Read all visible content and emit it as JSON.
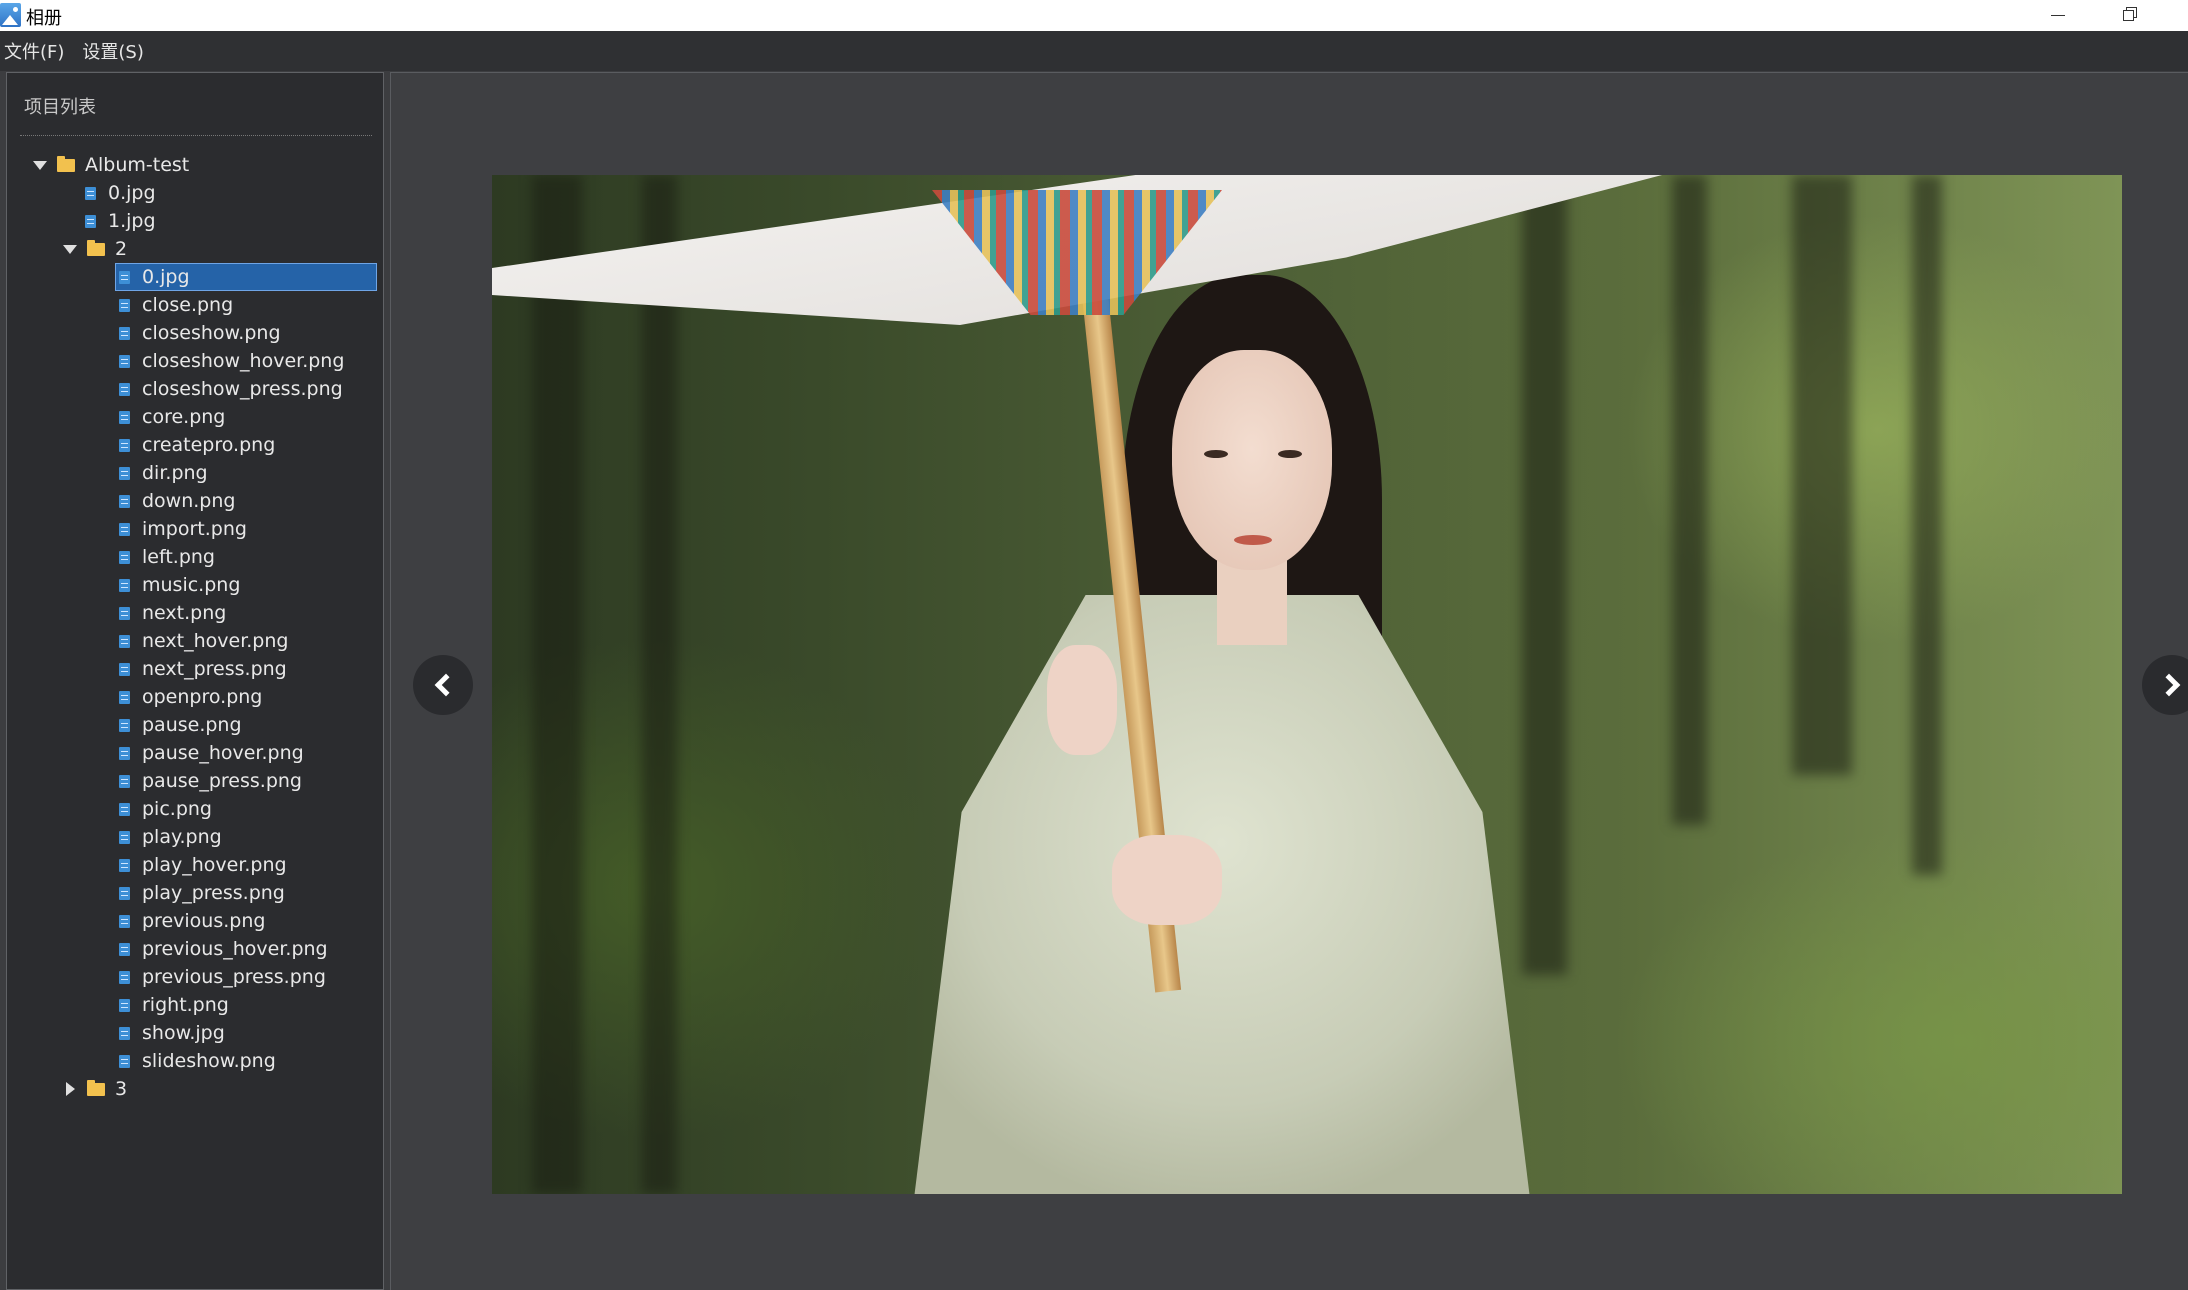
{
  "window": {
    "title": "相册",
    "controls": [
      "minimize",
      "restore"
    ]
  },
  "menu": {
    "file": "文件(F)",
    "settings": "设置(S)"
  },
  "sidebar": {
    "title": "项目列表",
    "tree": {
      "root": {
        "label": "Album-test",
        "expanded": true
      },
      "root_files": [
        "0.jpg",
        "1.jpg"
      ],
      "folder_2": {
        "label": "2",
        "expanded": true
      },
      "folder_2_files": [
        "0.jpg",
        "close.png",
        "closeshow.png",
        "closeshow_hover.png",
        "closeshow_press.png",
        "core.png",
        "createpro.png",
        "dir.png",
        "down.png",
        "import.png",
        "left.png",
        "music.png",
        "next.png",
        "next_hover.png",
        "next_press.png",
        "openpro.png",
        "pause.png",
        "pause_hover.png",
        "pause_press.png",
        "pic.png",
        "play.png",
        "play_hover.png",
        "play_press.png",
        "previous.png",
        "previous_hover.png",
        "previous_press.png",
        "right.png",
        "show.jpg",
        "slideshow.png"
      ],
      "selected_file": "0.jpg",
      "folder_3": {
        "label": "3",
        "expanded": false
      }
    }
  },
  "viewer": {
    "prev_icon": "chevron-left-icon",
    "next_icon": "chevron-right-icon"
  },
  "colors": {
    "selection": "#2563a8",
    "folder": "#f2c14e",
    "file": "#3d8fd6",
    "background": "#3c3d40"
  }
}
